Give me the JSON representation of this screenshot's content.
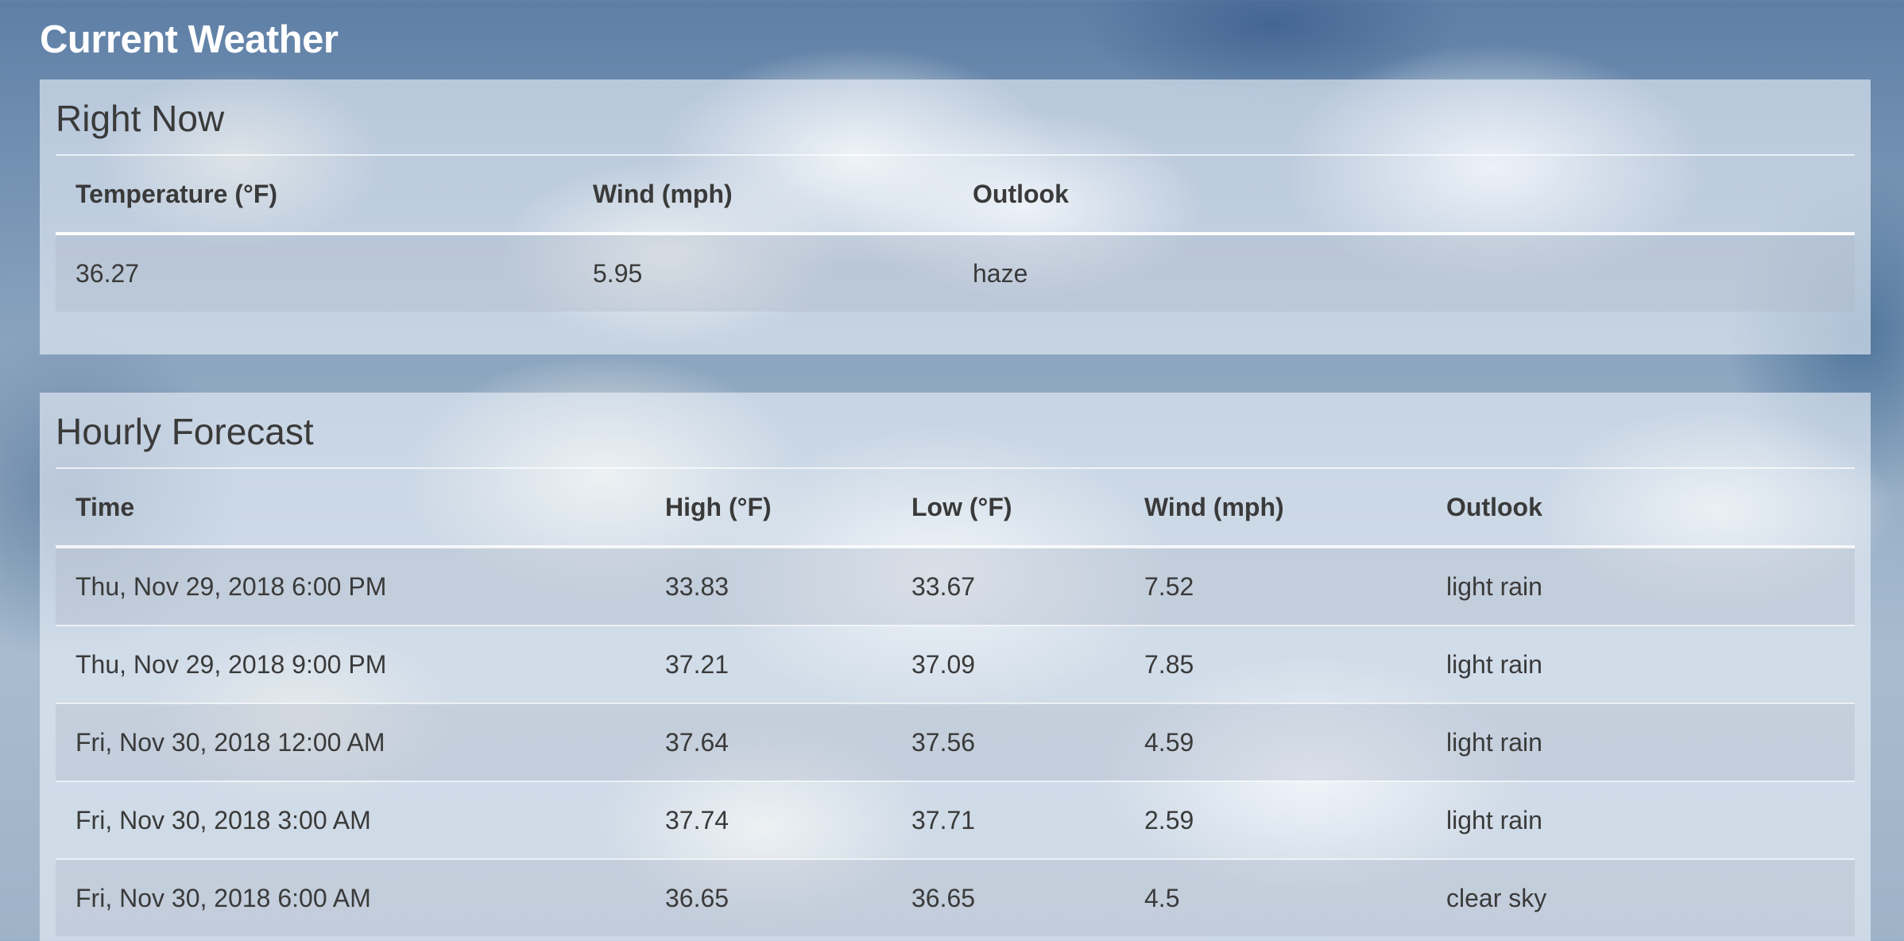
{
  "page": {
    "title": "Current Weather"
  },
  "right_now": {
    "title": "Right Now",
    "headers": [
      "Temperature (°F)",
      "Wind (mph)",
      "Outlook"
    ],
    "row": {
      "temperature": "36.27",
      "wind": "5.95",
      "outlook": "haze"
    }
  },
  "hourly": {
    "title": "Hourly Forecast",
    "headers": [
      "Time",
      "High (°F)",
      "Low (°F)",
      "Wind (mph)",
      "Outlook"
    ],
    "rows": [
      {
        "time": "Thu, Nov 29, 2018 6:00 PM",
        "high": "33.83",
        "low": "33.67",
        "wind": "7.52",
        "outlook": "light rain"
      },
      {
        "time": "Thu, Nov 29, 2018 9:00 PM",
        "high": "37.21",
        "low": "37.09",
        "wind": "7.85",
        "outlook": "light rain"
      },
      {
        "time": "Fri, Nov 30, 2018 12:00 AM",
        "high": "37.64",
        "low": "37.56",
        "wind": "4.59",
        "outlook": "light rain"
      },
      {
        "time": "Fri, Nov 30, 2018 3:00 AM",
        "high": "37.74",
        "low": "37.71",
        "wind": "2.59",
        "outlook": "light rain"
      },
      {
        "time": "Fri, Nov 30, 2018 6:00 AM",
        "high": "36.65",
        "low": "36.65",
        "wind": "4.5",
        "outlook": "clear sky"
      }
    ]
  }
}
